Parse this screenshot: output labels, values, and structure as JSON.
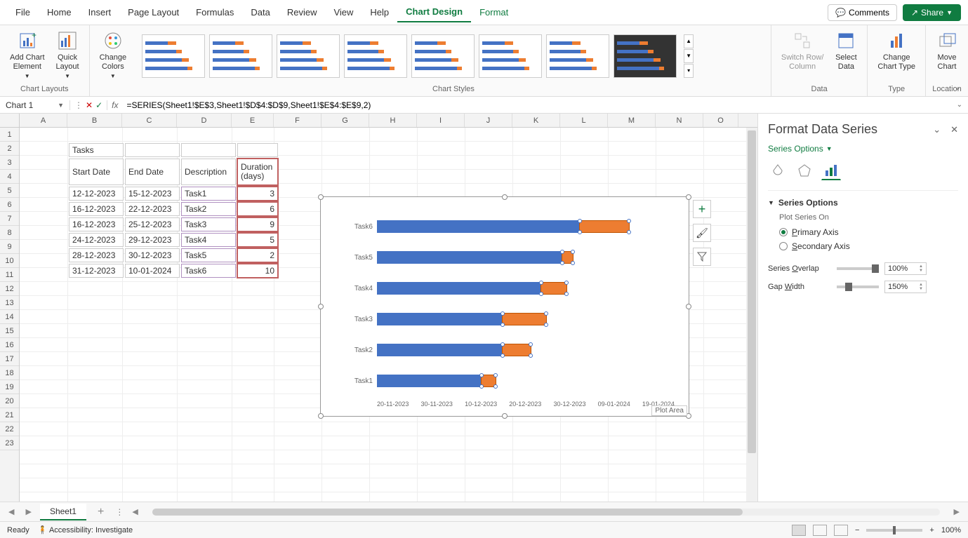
{
  "menu": {
    "tabs": [
      "File",
      "Home",
      "Insert",
      "Page Layout",
      "Formulas",
      "Data",
      "Review",
      "View",
      "Help",
      "Chart Design",
      "Format"
    ],
    "active": "Chart Design",
    "comments": "Comments",
    "share": "Share"
  },
  "ribbon": {
    "addChart": "Add Chart\nElement",
    "quickLayout": "Quick\nLayout",
    "changeColors": "Change\nColors",
    "switchRowCol": "Switch Row/\nColumn",
    "selectData": "Select\nData",
    "changeChartType": "Change\nChart Type",
    "moveChart": "Move\nChart",
    "groups": {
      "layouts": "Chart Layouts",
      "styles": "Chart Styles",
      "data": "Data",
      "type": "Type",
      "location": "Location"
    }
  },
  "formula": {
    "nameBox": "Chart 1",
    "formula": "=SERIES(Sheet1!$E$3,Sheet1!$D$4:$D$9,Sheet1!$E$4:$E$9,2)"
  },
  "columns": [
    "A",
    "B",
    "C",
    "D",
    "E",
    "F",
    "G",
    "H",
    "I",
    "J",
    "K",
    "L",
    "M",
    "N",
    "O"
  ],
  "sheet": {
    "b2": "Tasks",
    "headers": {
      "b3": "Start Date",
      "c3": "End Date",
      "d3": "Description",
      "e3": "Duration (days)"
    },
    "rows": [
      {
        "start": "12-12-2023",
        "end": "15-12-2023",
        "desc": "Task1",
        "dur": "3"
      },
      {
        "start": "16-12-2023",
        "end": "22-12-2023",
        "desc": "Task2",
        "dur": "6"
      },
      {
        "start": "16-12-2023",
        "end": "25-12-2023",
        "desc": "Task3",
        "dur": "9"
      },
      {
        "start": "24-12-2023",
        "end": "29-12-2023",
        "desc": "Task4",
        "dur": "5"
      },
      {
        "start": "28-12-2023",
        "end": "30-12-2023",
        "desc": "Task5",
        "dur": "2"
      },
      {
        "start": "31-12-2023",
        "end": "10-01-2024",
        "desc": "Task6",
        "dur": "10"
      }
    ]
  },
  "chart_data": {
    "type": "bar",
    "categories": [
      "Task6",
      "Task5",
      "Task4",
      "Task3",
      "Task2",
      "Task1"
    ],
    "series": [
      {
        "name": "Start Date",
        "values_label": [
          "31-12-2023",
          "28-12-2023",
          "24-12-2023",
          "16-12-2023",
          "16-12-2023",
          "12-12-2023"
        ],
        "offsets_pct": [
          68,
          62,
          55,
          42,
          42,
          35
        ]
      },
      {
        "name": "Duration (days)",
        "values": [
          10,
          2,
          5,
          9,
          6,
          3
        ],
        "widths_pct": [
          17,
          4,
          9,
          15,
          10,
          5
        ]
      }
    ],
    "xaxis": [
      "20-11-2023",
      "30-11-2023",
      "10-12-2023",
      "20-12-2023",
      "30-12-2023",
      "09-01-2024",
      "19-01-2024"
    ],
    "plot_area_tip": "Plot Area"
  },
  "chart_buttons": {
    "plus": "+",
    "brush": "brush",
    "filter": "filter"
  },
  "panel": {
    "title": "Format Data Series",
    "sub": "Series Options",
    "section": "Series Options",
    "plotOn": "Plot Series On",
    "primary": "Primary Axis",
    "secondary": "Secondary Axis",
    "overlap": "Series Overlap",
    "overlapVal": "100%",
    "gap": "Gap Width",
    "gapVal": "150%"
  },
  "sheetTabs": {
    "sheet1": "Sheet1"
  },
  "status": {
    "ready": "Ready",
    "accessibility": "Accessibility: Investigate",
    "zoom": "100%"
  }
}
